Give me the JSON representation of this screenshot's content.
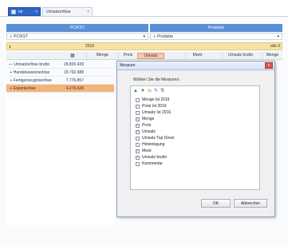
{
  "tabs": [
    {
      "label": "Ist",
      "active": true
    },
    {
      "label": "Umsatzerlöse",
      "active": false
    }
  ],
  "dims": {
    "left": {
      "header": "PC/KST",
      "selected": "PC/KST"
    },
    "right": {
      "header": "Produkte",
      "selected": "Produkte"
    }
  },
  "yellowbar": {
    "year": "2016",
    "right_label": "alle 0"
  },
  "columns": [
    "Menge",
    "Preis",
    "Umsatz",
    "Mwst",
    "Umsatz brutto",
    "Menge"
  ],
  "rows": [
    {
      "name": "Umsatzerlöse brutto",
      "value": "28.800.439",
      "highlighted": false
    },
    {
      "name": "Handelswarenerlöse",
      "value": "18.792.988",
      "highlighted": false
    },
    {
      "name": "Fertigerzeugniserlöse",
      "value": "7.776.857",
      "highlighted": false
    },
    {
      "name": "Exporterlöse",
      "value": "4.276.626",
      "highlighted": true
    }
  ],
  "dialog": {
    "title": "Measure",
    "close": "x",
    "instruction": "Wählen Sie die Measures:",
    "items": [
      {
        "label": "Menge Ist 2016",
        "checked": false
      },
      {
        "label": "Preis Ist 2016",
        "checked": false
      },
      {
        "label": "Umsatz Ist 2016",
        "checked": false
      },
      {
        "label": "Menge",
        "checked": true
      },
      {
        "label": "Preis",
        "checked": true
      },
      {
        "label": "Umsatz",
        "checked": true
      },
      {
        "label": "Umsatz Top Down",
        "checked": false
      },
      {
        "label": "Hinterlegung",
        "checked": false
      },
      {
        "label": "Mwst",
        "checked": true
      },
      {
        "label": "Umsatz brutto",
        "checked": true
      },
      {
        "label": "Kommentar",
        "checked": false
      }
    ],
    "ok": "OK",
    "cancel": "Abbrechen"
  },
  "colors": {
    "accent": "#2e66c7",
    "header": "#5b8fd6",
    "yellow": "#f7e3a6",
    "highlight": "#f3b47a"
  }
}
